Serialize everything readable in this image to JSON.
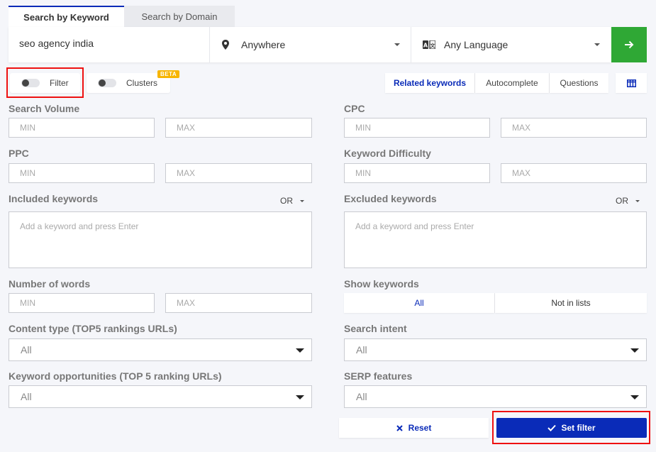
{
  "tabs": {
    "keyword": "Search by Keyword",
    "domain": "Search by Domain"
  },
  "search": {
    "keyword_value": "seo agency india",
    "location": "Anywhere",
    "language": "Any Language",
    "go_icon": "arrow-right-icon",
    "go_color": "#2fa835"
  },
  "toggles": {
    "filter_label": "Filter",
    "clusters_label": "Clusters",
    "beta_badge": "BETA"
  },
  "modes": {
    "related": "Related keywords",
    "autocomplete": "Autocomplete",
    "questions": "Questions",
    "columns_icon": "columns-icon"
  },
  "filters": {
    "min_placeholder": "MIN",
    "max_placeholder": "MAX",
    "search_volume": "Search Volume",
    "cpc": "CPC",
    "ppc": "PPC",
    "keyword_difficulty": "Keyword Difficulty",
    "included_keywords": "Included keywords",
    "excluded_keywords": "Excluded keywords",
    "or_label": "OR",
    "keyword_placeholder": "Add a keyword and press Enter",
    "number_of_words": "Number of words",
    "show_keywords": "Show keywords",
    "show_all": "All",
    "show_not_in_lists": "Not in lists",
    "content_type": "Content type (TOP5 rankings URLs)",
    "search_intent": "Search intent",
    "keyword_opportunities": "Keyword opportunities (TOP 5 ranking URLs)",
    "serp_features": "SERP features",
    "all_option": "All"
  },
  "actions": {
    "reset": "Reset",
    "set_filter": "Set filter"
  },
  "colors": {
    "accent": "#0a2bb8",
    "highlight": "#e11111",
    "beta": "#f7b500"
  }
}
